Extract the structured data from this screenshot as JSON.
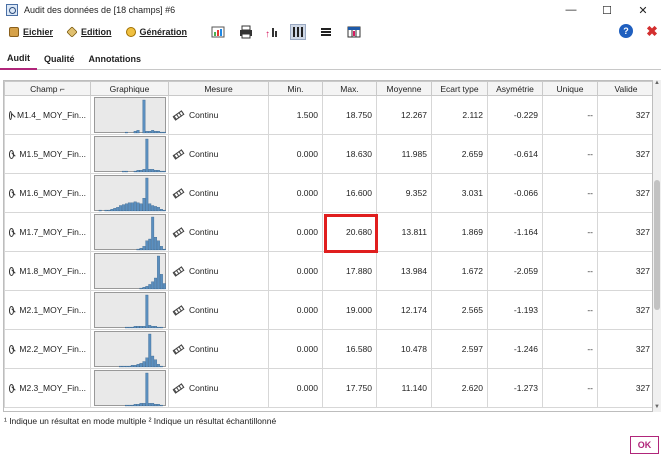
{
  "window": {
    "title": "Audit des données de [18 champs] #6",
    "minimize": "—",
    "maximize": "☐",
    "close": "✕"
  },
  "toolbar": {
    "file_label": "Eichier",
    "edit_label": "Edition",
    "gen_label": "Génération",
    "icons": [
      "chart-icon",
      "print-icon",
      "field-ops-icon",
      "columns-icon",
      "rows-icon",
      "table-icon"
    ],
    "help_label": "?",
    "close_label": "✖"
  },
  "tabs": [
    {
      "label": "Audit",
      "active": true
    },
    {
      "label": "Qualité",
      "active": false
    },
    {
      "label": "Annotations",
      "active": false
    }
  ],
  "table": {
    "headers": {
      "champ": "Champ",
      "sort_indicator": "⌐",
      "graphique": "Graphique",
      "mesure": "Mesure",
      "min": "Min.",
      "max": "Max.",
      "moyenne": "Moyenne",
      "ecart": "Ecart type",
      "asym": "Asymétrie",
      "unique": "Unique",
      "valide": "Valide"
    },
    "rows": [
      {
        "field": "M1.4_ MOY_Fin...",
        "measure": "Continu",
        "min": "1.500",
        "max": "18.750",
        "mean": "12.267",
        "std": "2.112",
        "skew": "-0.229",
        "unique": "--",
        "valid": "327",
        "hist": [
          0,
          0,
          0,
          0,
          0,
          0,
          0,
          0,
          0,
          0,
          1,
          0,
          0,
          2,
          3,
          0,
          36,
          2,
          2,
          3,
          2,
          2,
          1,
          1
        ]
      },
      {
        "field": "M1.5_MOY_Fin...",
        "measure": "Continu",
        "min": "0.000",
        "max": "18.630",
        "mean": "11.985",
        "std": "2.659",
        "skew": "-0.614",
        "unique": "--",
        "valid": "327",
        "hist": [
          0,
          0,
          0,
          0,
          0,
          0,
          0,
          0,
          0,
          1,
          1,
          0,
          0,
          1,
          2,
          2,
          3,
          36,
          3,
          3,
          2,
          2,
          1,
          1
        ]
      },
      {
        "field": "M1.6_MOY_Fin...",
        "measure": "Continu",
        "min": "0.000",
        "max": "16.600",
        "mean": "9.352",
        "std": "3.031",
        "skew": "-0.066",
        "unique": "--",
        "valid": "327",
        "hist": [
          0,
          1,
          0,
          1,
          1,
          2,
          3,
          4,
          6,
          7,
          8,
          9,
          9,
          10,
          9,
          8,
          14,
          36,
          8,
          6,
          5,
          4,
          2,
          1
        ]
      },
      {
        "field": "M1.7_MOY_Fin...",
        "measure": "Continu",
        "min": "0.000",
        "max": "20.680",
        "mean": "13.811",
        "std": "1.869",
        "skew": "-1.164",
        "unique": "--",
        "valid": "327",
        "hist": [
          0,
          0,
          0,
          0,
          0,
          0,
          0,
          0,
          0,
          0,
          0,
          0,
          0,
          0,
          1,
          2,
          4,
          10,
          12,
          36,
          14,
          10,
          4,
          1
        ]
      },
      {
        "field": "M1.8_MOY_Fin...",
        "measure": "Continu",
        "min": "0.000",
        "max": "17.880",
        "mean": "13.984",
        "std": "1.672",
        "skew": "-2.059",
        "unique": "--",
        "valid": "327",
        "hist": [
          0,
          0,
          0,
          0,
          0,
          0,
          0,
          0,
          0,
          0,
          0,
          0,
          0,
          0,
          0,
          1,
          2,
          3,
          5,
          8,
          12,
          36,
          16,
          6
        ]
      },
      {
        "field": "M2.1_MOY_Fin...",
        "measure": "Continu",
        "min": "0.000",
        "max": "19.000",
        "mean": "12.174",
        "std": "2.565",
        "skew": "-1.193",
        "unique": "--",
        "valid": "327",
        "hist": [
          0,
          0,
          0,
          0,
          0,
          0,
          0,
          0,
          0,
          0,
          1,
          1,
          1,
          2,
          2,
          2,
          2,
          36,
          3,
          2,
          2,
          1,
          1,
          0
        ]
      },
      {
        "field": "M2.2_MOY_Fin...",
        "measure": "Continu",
        "min": "0.000",
        "max": "16.580",
        "mean": "10.478",
        "std": "2.597",
        "skew": "-1.246",
        "unique": "--",
        "valid": "327",
        "hist": [
          0,
          0,
          0,
          0,
          0,
          0,
          0,
          0,
          1,
          1,
          1,
          1,
          2,
          2,
          3,
          4,
          6,
          10,
          36,
          12,
          8,
          3,
          1,
          0
        ]
      },
      {
        "field": "M2.3_MOY_Fin...",
        "measure": "Continu",
        "min": "0.000",
        "max": "17.750",
        "mean": "11.140",
        "std": "2.620",
        "skew": "-1.273",
        "unique": "--",
        "valid": "327",
        "hist": [
          0,
          0,
          0,
          0,
          0,
          0,
          0,
          0,
          0,
          0,
          1,
          1,
          1,
          2,
          2,
          3,
          3,
          36,
          3,
          3,
          2,
          2,
          1,
          0
        ]
      }
    ]
  },
  "footnote": "¹ Indique un résultat en mode multiple    ² Indique un résultat  échantillonné",
  "ok_label": "OK",
  "colors": {
    "accent": "#b0257a",
    "highlight": "#e01e1e",
    "bar": "#5b8fbf"
  }
}
